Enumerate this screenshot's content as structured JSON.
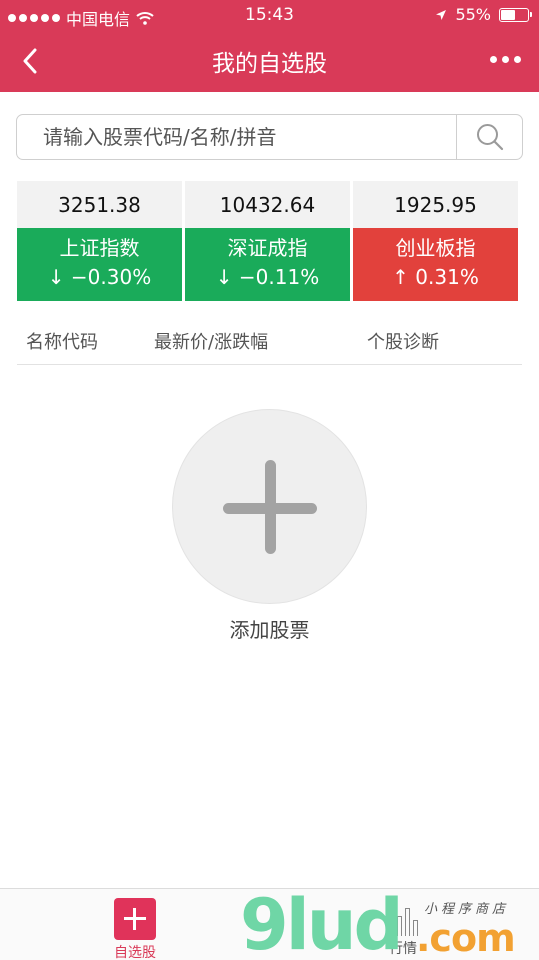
{
  "status_bar": {
    "carrier": "中国电信",
    "time": "15:43",
    "battery": "55%",
    "battery_level": 0.55,
    "icons": [
      "signal-dots-icon",
      "wifi-icon",
      "location-arrow-icon",
      "battery-icon"
    ]
  },
  "nav": {
    "title": "我的自选股",
    "back_icon": "chevron-left-icon",
    "more_icon": "more-dots-icon"
  },
  "search": {
    "placeholder": "请输入股票代码/名称/拼音",
    "value": "",
    "icon": "search-icon"
  },
  "indices": [
    {
      "value": "3251.38",
      "name": "上证指数",
      "arrow": "↓",
      "change": "−0.30%",
      "direction": "down",
      "color": "#1aab5a"
    },
    {
      "value": "10432.64",
      "name": "深证成指",
      "arrow": "↓",
      "change": "−0.11%",
      "direction": "down",
      "color": "#1aab5a"
    },
    {
      "value": "1925.95",
      "name": "创业板指",
      "arrow": "↑",
      "change": "0.31%",
      "direction": "up",
      "color": "#e2413c"
    }
  ],
  "columns": [
    "名称代码",
    "最新价/涨跌幅",
    "个股诊断"
  ],
  "add_stock": {
    "label": "添加股票",
    "icon": "plus-icon"
  },
  "tabbar": {
    "tabs": [
      {
        "label": "自选股",
        "icon": "plus-square-icon",
        "active": true
      },
      {
        "label": "行情",
        "icon": "bar-chart-icon",
        "active": false
      }
    ]
  },
  "watermark": {
    "text": "9lud",
    "suffix": ".com",
    "tagline": "小程序商店"
  },
  "colors": {
    "brand": "#d93a58",
    "down": "#1aab5a",
    "up": "#e2413c"
  }
}
